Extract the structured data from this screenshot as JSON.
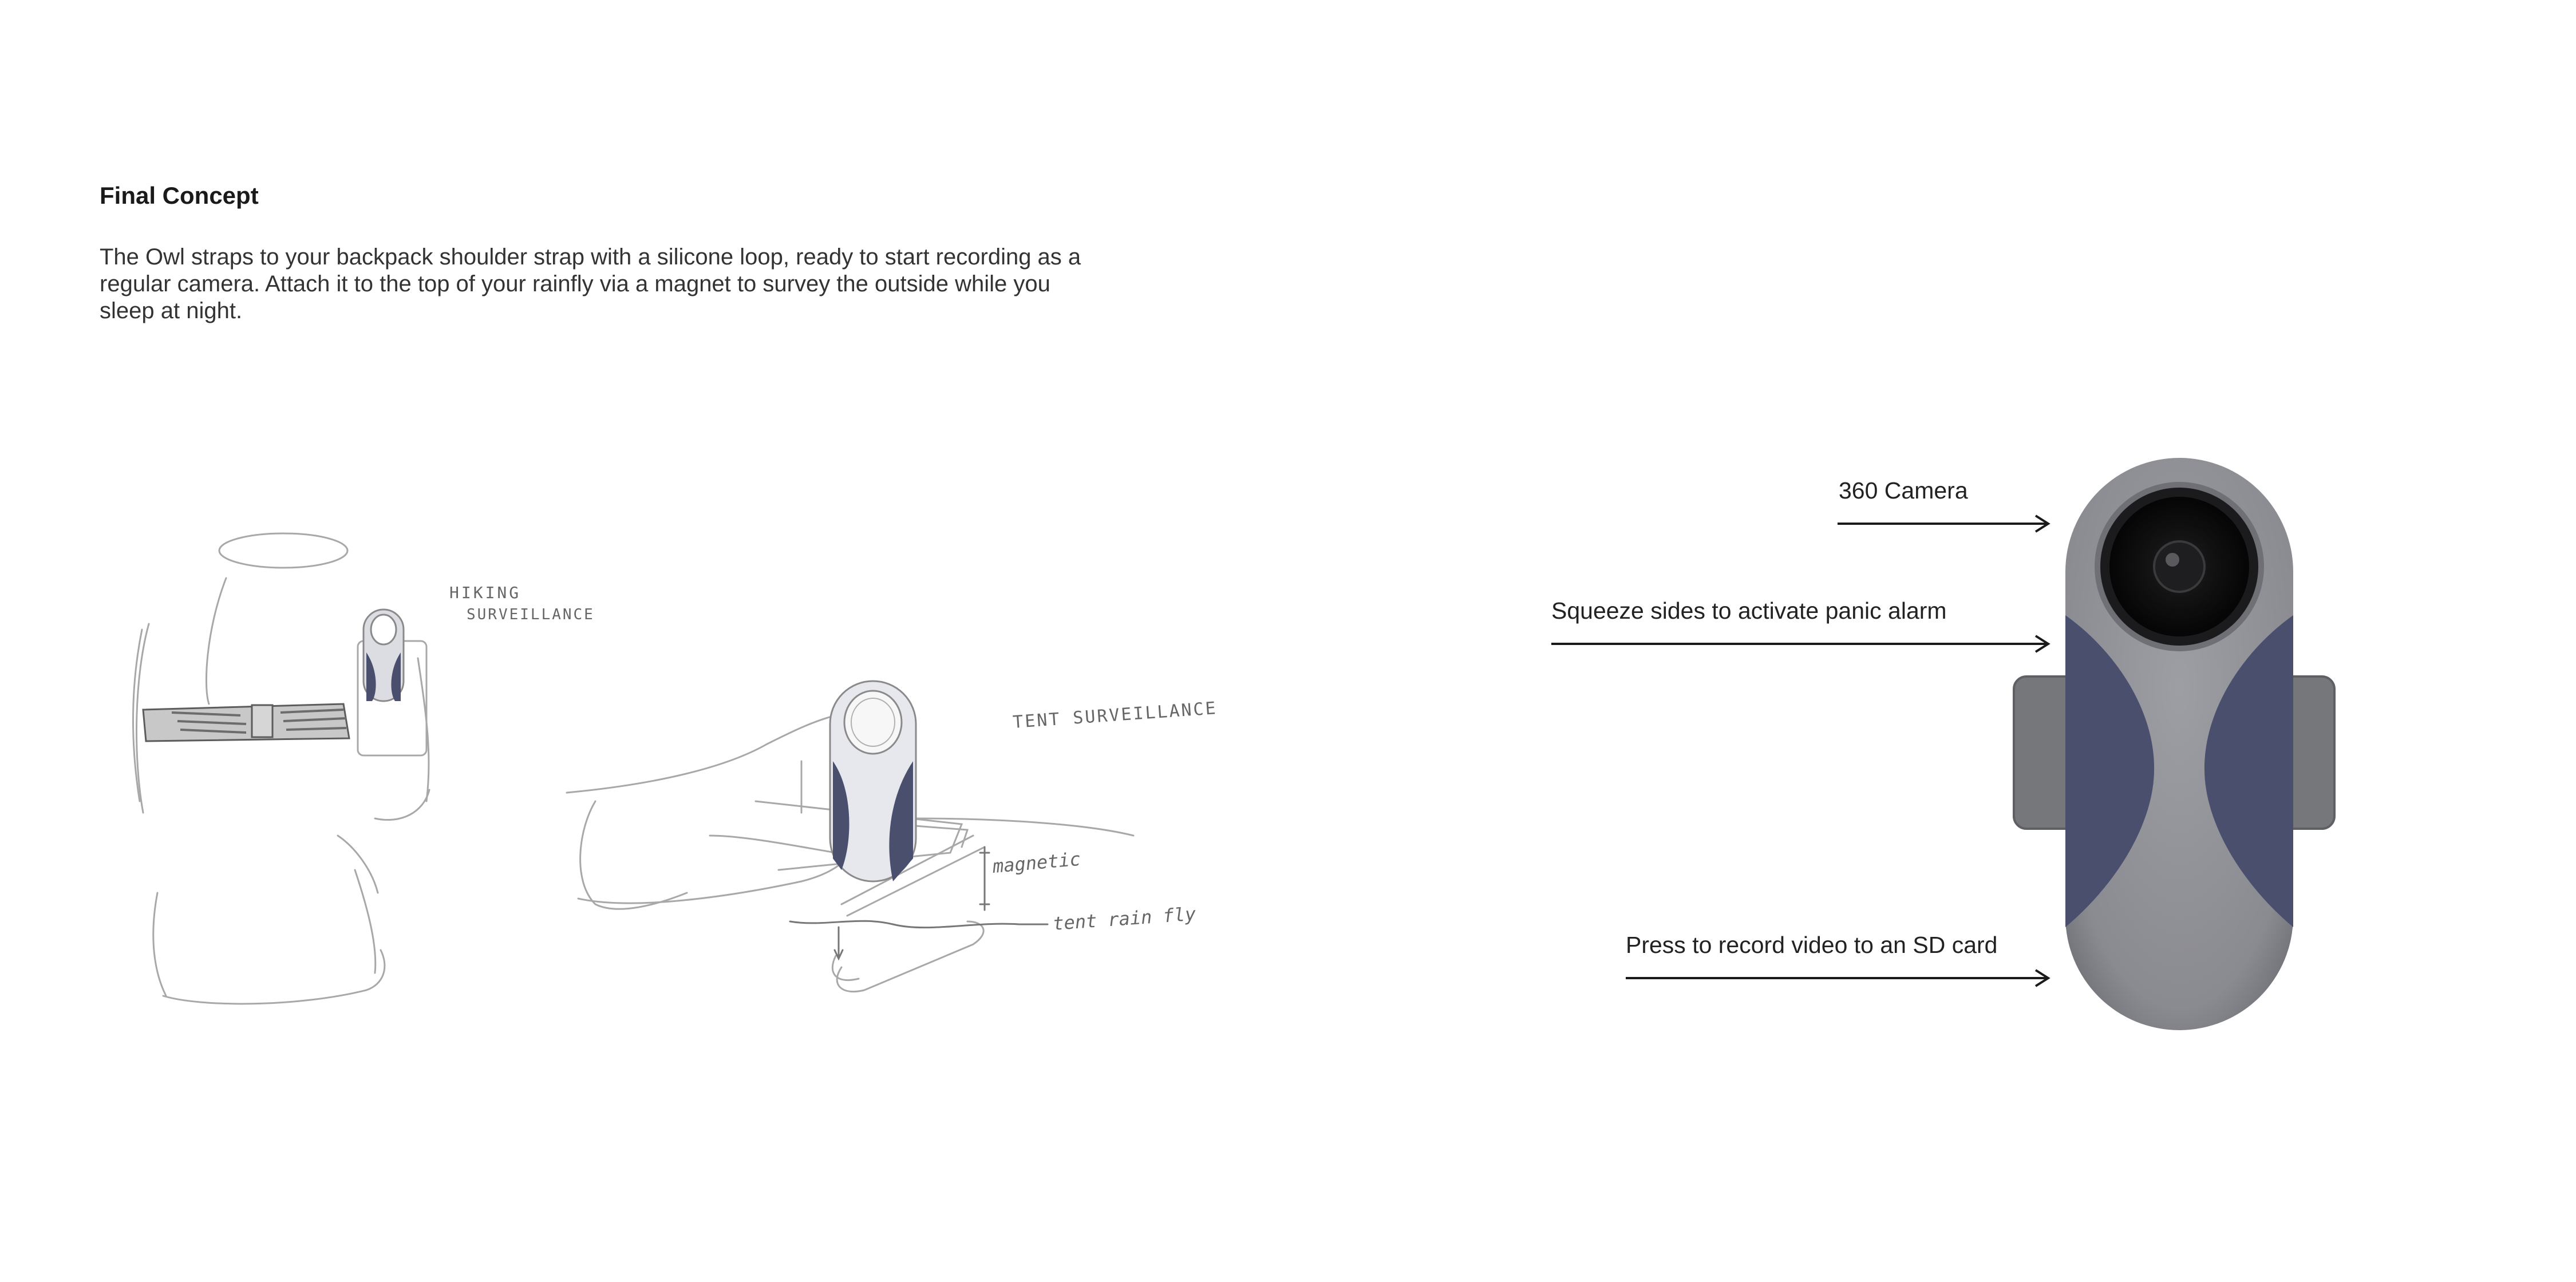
{
  "header": {
    "title": "Final Concept",
    "description": "The Owl straps to your backpack shoulder strap with a silicone loop, ready to start recording as a regular camera. Attach it to the top of your rainfly via a magnet to survey the outside while you sleep at night."
  },
  "sketches": {
    "hiking_label_line1": "HIKING",
    "hiking_label_line2": "SURVEILLANCE",
    "tent_label": "TENT SURVEILLANCE",
    "magnetic_label": "magnetic",
    "rain_fly_label": "tent rain fly"
  },
  "callouts": {
    "camera": "360 Camera",
    "panic": "Squeeze sides to activate panic alarm",
    "record": "Press to record video to an SD card"
  },
  "colors": {
    "device_body": "#8e8f95",
    "device_grip": "#4a4f6e",
    "strap": "#7a7b7e",
    "sketch_line": "#9a9a9a",
    "arrow": "#1a1a1a"
  }
}
